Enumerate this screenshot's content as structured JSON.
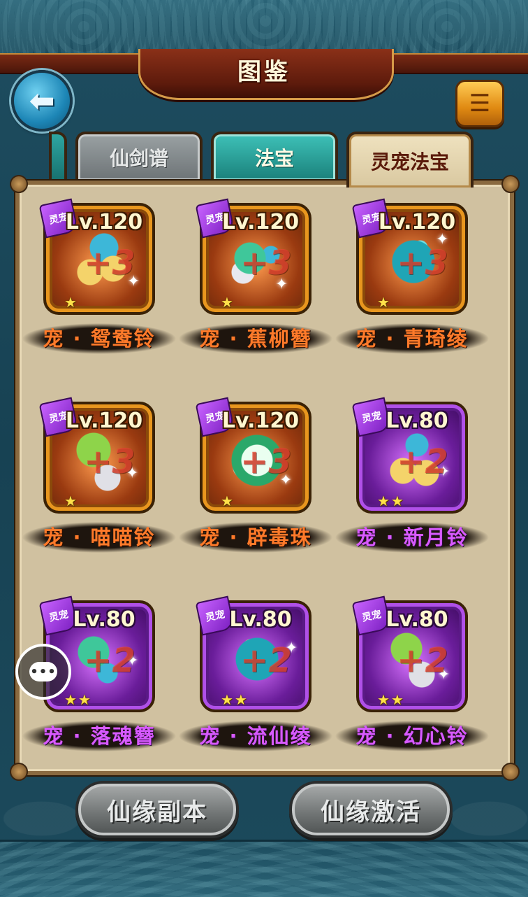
{
  "header": {
    "title": "图鉴",
    "back_icon": "back-arrow-icon",
    "menu_icon": "list-icon"
  },
  "tabs": [
    {
      "label": "",
      "state": "partial"
    },
    {
      "label": "仙剑谱",
      "state": "inactive"
    },
    {
      "label": "法宝",
      "state": "inactive"
    },
    {
      "label": "灵宠法宝",
      "state": "active"
    }
  ],
  "items": [
    {
      "level": "Lv.120",
      "plus": "+3",
      "name": "宠 · 鸳鸯铃",
      "stars": "★",
      "tag": "灵宠",
      "rarity": "orange"
    },
    {
      "level": "Lv.120",
      "plus": "+3",
      "name": "宠 · 蕉柳簪",
      "stars": "★",
      "tag": "灵宠",
      "rarity": "orange"
    },
    {
      "level": "Lv.120",
      "plus": "+3",
      "name": "宠 · 青琦绫",
      "stars": "★",
      "tag": "灵宠",
      "rarity": "orange"
    },
    {
      "level": "Lv.120",
      "plus": "+3",
      "name": "宠 · 喵喵铃",
      "stars": "★",
      "tag": "灵宠",
      "rarity": "orange"
    },
    {
      "level": "Lv.120",
      "plus": "+3",
      "name": "宠 · 辟毒珠",
      "stars": "★",
      "tag": "灵宠",
      "rarity": "orange"
    },
    {
      "level": "Lv.80",
      "plus": "+2",
      "name": "宠 · 新月铃",
      "stars": "★★",
      "tag": "灵宠",
      "rarity": "purple"
    },
    {
      "level": "Lv.80",
      "plus": "+2",
      "name": "宠 · 落魂簪",
      "stars": "★★",
      "tag": "灵宠",
      "rarity": "purple"
    },
    {
      "level": "Lv.80",
      "plus": "+2",
      "name": "宠 · 流仙绫",
      "stars": "★★",
      "tag": "灵宠",
      "rarity": "purple"
    },
    {
      "level": "Lv.80",
      "plus": "+2",
      "name": "宠 · 幻心铃",
      "stars": "★★",
      "tag": "灵宠",
      "rarity": "purple"
    }
  ],
  "chat": {
    "icon": "chat-bubble-icon",
    "glyph": "•••"
  },
  "footer": {
    "left_button": "仙缘副本",
    "right_button": "仙缘激活"
  },
  "colors": {
    "orange_name": "#ff7a2a",
    "purple_name": "#d85aff",
    "star": "#ffe14a"
  }
}
